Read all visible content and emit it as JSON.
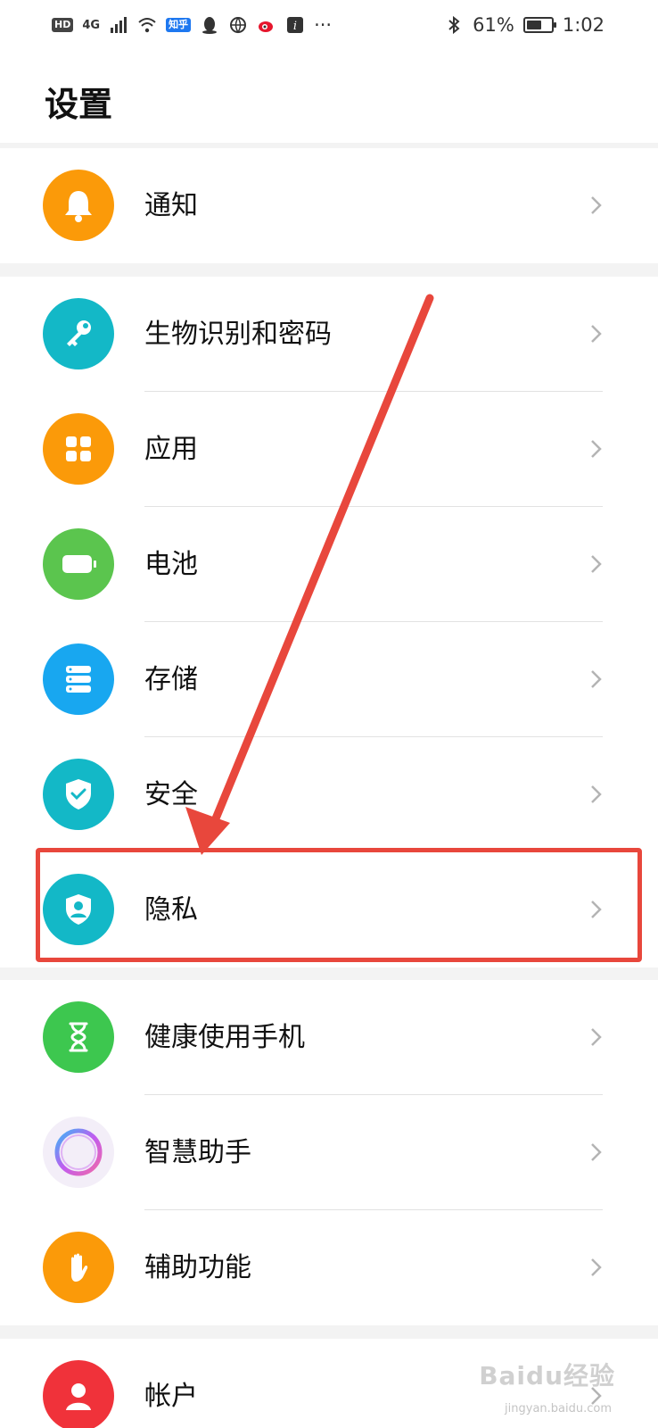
{
  "status_bar": {
    "hd": "HD",
    "network": "4G",
    "zhihu": "知乎",
    "more": "···",
    "battery_percent": "61%",
    "battery_level": 0.61,
    "time": "1:02"
  },
  "header": {
    "title": "设置"
  },
  "groups": [
    {
      "items": [
        {
          "label": "通知",
          "icon": "bell-icon",
          "color": "#fb9a09"
        }
      ]
    },
    {
      "items": [
        {
          "label": "生物识别和密码",
          "icon": "key-icon",
          "color": "#13b8c7"
        },
        {
          "label": "应用",
          "icon": "apps-grid-icon",
          "color": "#fb9a09"
        },
        {
          "label": "电池",
          "icon": "battery-icon",
          "color": "#5bc54e"
        },
        {
          "label": "存储",
          "icon": "storage-icon",
          "color": "#18a7f0"
        },
        {
          "label": "安全",
          "icon": "shield-check-icon",
          "color": "#13b8c7"
        },
        {
          "label": "隐私",
          "icon": "privacy-shield-icon",
          "color": "#13b8c7"
        }
      ]
    },
    {
      "items": [
        {
          "label": "健康使用手机",
          "icon": "hourglass-icon",
          "color": "#3dc74f"
        },
        {
          "label": "智慧助手",
          "icon": "assistant-ring-icon",
          "color": "#f3eef8"
        },
        {
          "label": "辅助功能",
          "icon": "hand-icon",
          "color": "#fb9a09"
        }
      ]
    },
    {
      "items": [
        {
          "label": "帐户",
          "icon": "account-icon",
          "color": "#f0323a"
        }
      ]
    }
  ],
  "annotation": {
    "arrow_color": "#e8473c"
  },
  "watermark": {
    "text": "Baidu经验",
    "sub": "jingyan.baidu.com"
  }
}
